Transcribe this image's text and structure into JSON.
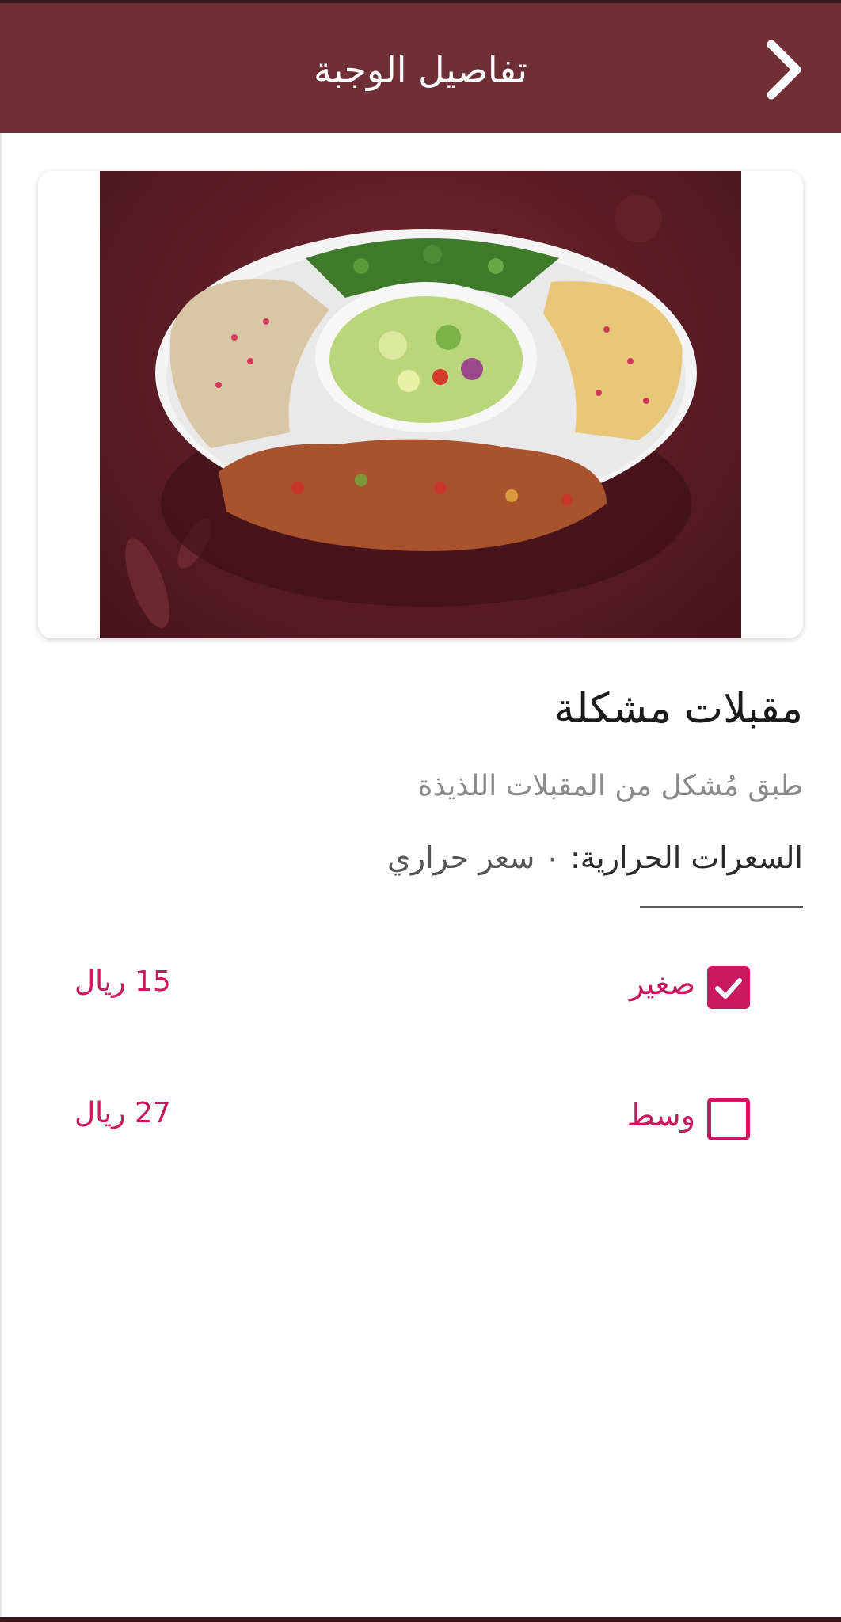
{
  "header": {
    "title": "تفاصيل الوجبة",
    "back_icon": "chevron-right-icon"
  },
  "dish": {
    "name": "مقبلات مشكلة",
    "description": "طبق مُشكل من المقبلات اللذيذة",
    "calories_label": "السعرات الحرارية:",
    "calories_value": "٠ سعر حراري"
  },
  "sizes": [
    {
      "label": "صغير",
      "price": "15 ريال",
      "selected": true
    },
    {
      "label": "وسط",
      "price": "27 ريال",
      "selected": false
    }
  ],
  "colors": {
    "header_bg": "#6e2f36",
    "accent": "#c8195e"
  }
}
